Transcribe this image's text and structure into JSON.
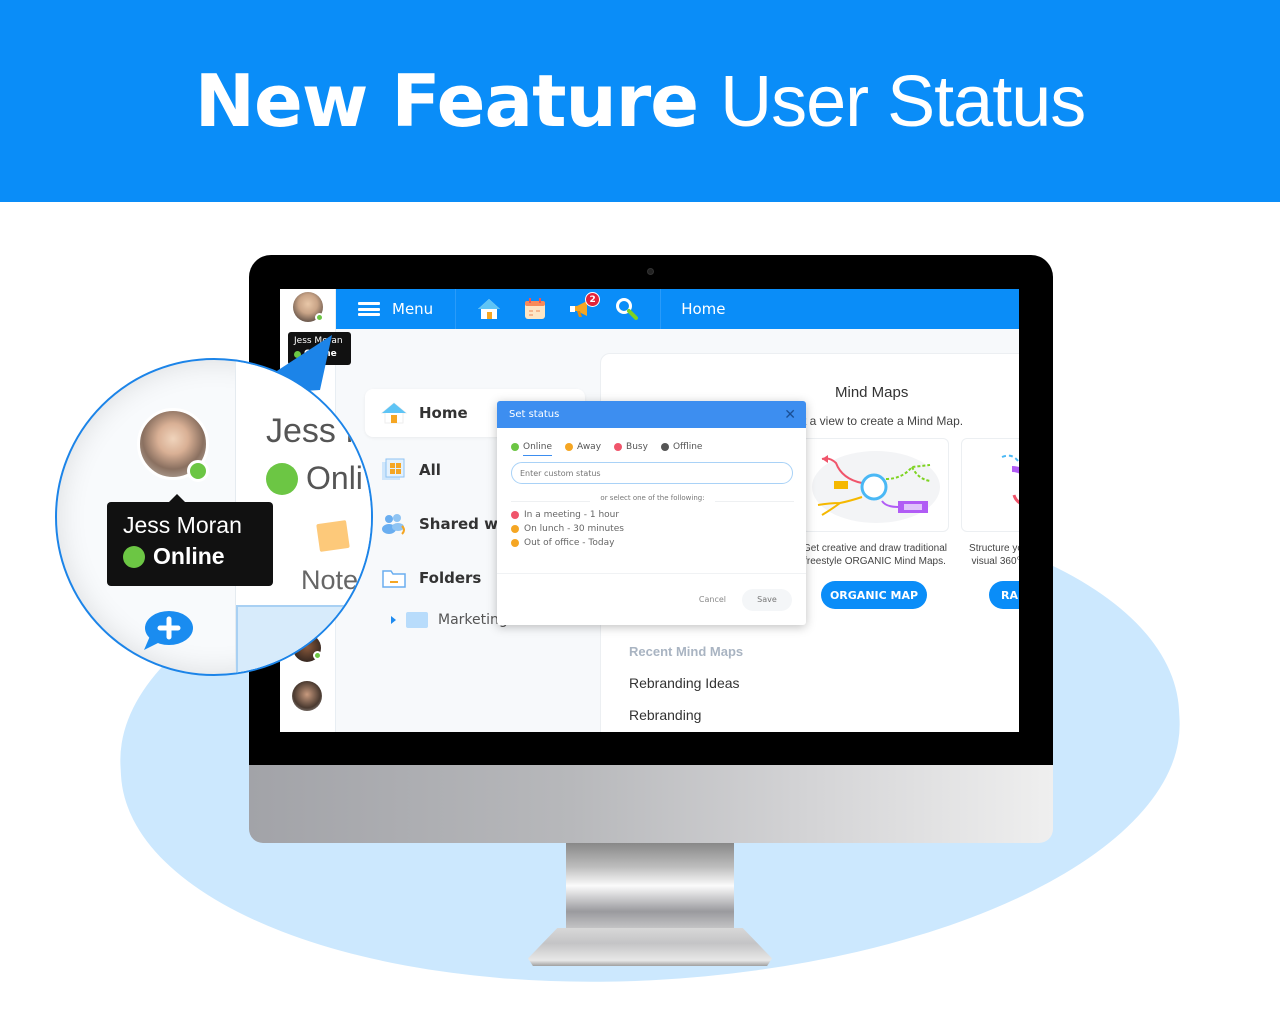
{
  "banner": {
    "title_bold": "New Feature",
    "title_light": "User Status"
  },
  "colors": {
    "brand_blue": "#0a8df8",
    "online": "#6cc644",
    "away": "#f5a623",
    "busy": "#f0556b",
    "offline": "#555555",
    "background_blob": "#cce8fe"
  },
  "app": {
    "topbar": {
      "menu_label": "Menu",
      "icons": [
        "home-icon",
        "calendar-icon",
        "megaphone-icon",
        "search-icon"
      ],
      "notification_count": "2",
      "page_title": "Home"
    },
    "user": {
      "name": "Jess Moran",
      "status": "Online"
    },
    "nav": {
      "items": [
        {
          "label": "Home",
          "icon": "home-icon",
          "active": true
        },
        {
          "label": "All",
          "icon": "grid-icon"
        },
        {
          "label": "Shared with",
          "icon": "people-icon"
        },
        {
          "label": "Folders",
          "icon": "folder-icon"
        }
      ],
      "subfolders": [
        {
          "label": "Marketing"
        }
      ]
    },
    "content": {
      "title": "Mind Maps",
      "subtitle": "ct a view to create a Mind Map.",
      "templates": [
        {
          "desc_line1": "Get creative and draw traditional",
          "desc_line2": "freestyle ORGANIC Mind Maps.",
          "button": "ORGANIC MAP"
        },
        {
          "desc_line1": "Structure yo",
          "desc_line2": "visual 360°",
          "button": "RA"
        }
      ],
      "recent_heading": "Recent Mind Maps",
      "recent": [
        "Rebranding Ideas",
        "Rebranding"
      ]
    },
    "dialog": {
      "title": "Set status",
      "close": "✕",
      "statuses": [
        {
          "label": "Online",
          "color": "#6cc644",
          "active": true
        },
        {
          "label": "Away",
          "color": "#f5a623"
        },
        {
          "label": "Busy",
          "color": "#f0556b"
        },
        {
          "label": "Offline",
          "color": "#555555"
        }
      ],
      "custom_placeholder": "Enter custom status",
      "or_text": "or select one of the following:",
      "presets": [
        {
          "label": "In a meeting - 1 hour",
          "color": "#f0556b"
        },
        {
          "label": "On lunch - 30 minutes",
          "color": "#f5a623"
        },
        {
          "label": "Out of office - Today",
          "color": "#f5a623"
        }
      ],
      "cancel_label": "Cancel",
      "save_label": "Save"
    }
  },
  "magnifier": {
    "name": "Jess Moran",
    "status": "Online",
    "partial_name": "Jess M",
    "partial_status": "Onli",
    "partial_note": "Note"
  }
}
